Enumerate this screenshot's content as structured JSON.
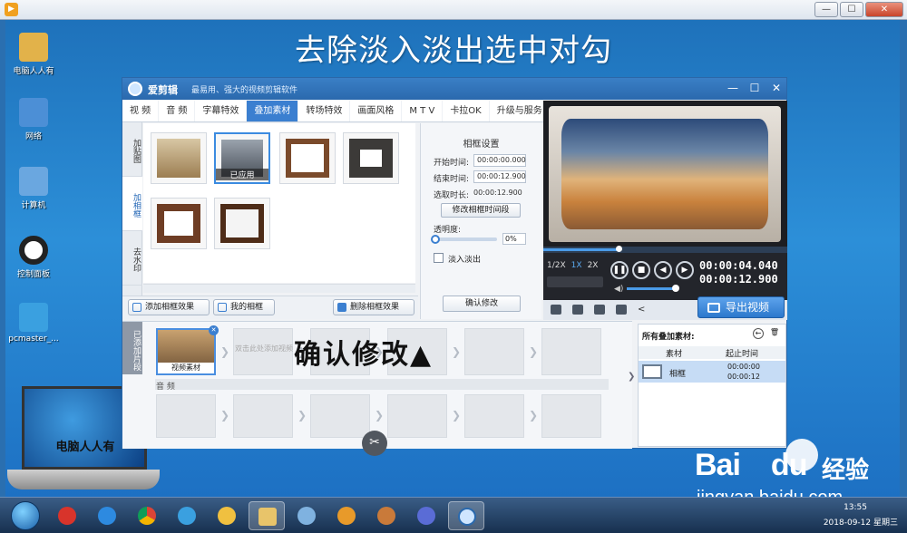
{
  "overlay_title": "去除淡入淡出选中对勾",
  "desktop_icons": [
    {
      "label": "电脑人人有",
      "color": "#e2b24a"
    },
    {
      "label": "网络",
      "color": "#4c8fd6"
    },
    {
      "label": "计算机",
      "color": "#6aa7e0"
    },
    {
      "label": "控制面板",
      "color": "#222222"
    },
    {
      "label": "pcmaster_...",
      "color": "#3aa0e0"
    }
  ],
  "logo_text": "电脑人人有",
  "app": {
    "name": "爱剪辑",
    "slogan": "最易用、强大的视频剪辑软件",
    "window_controls": [
      "—",
      "☐",
      "✕"
    ],
    "tabs": [
      "视  频",
      "音  频",
      "字幕特效",
      "叠加素材",
      "转场特效",
      "画面风格",
      "M T V",
      "卡拉OK",
      "升级与服务"
    ],
    "active_tab_index": 3,
    "side_tabs": [
      "加贴图",
      "加相框",
      "去水印"
    ],
    "active_side_tab_index": 1,
    "applied_label": "已应用",
    "buttons": {
      "add_frame": "添加相框效果",
      "my_frames": "我的相框",
      "delete_frame": "删除相框效果"
    }
  },
  "settings": {
    "title": "相框设置",
    "start_label": "开始时间:",
    "start_value": "00:00:00.000",
    "end_label": "结束时间:",
    "end_value": "00:00:12.900",
    "duration_label": "选取时长:",
    "duration_value": "00:00:12.900",
    "modify_time_button": "修改相框时间段",
    "opacity_label": "透明度:",
    "opacity_value": "0%",
    "fade_label": "淡入淡出",
    "fade_checked": false,
    "confirm_button": "确认修改"
  },
  "preview": {
    "speeds": [
      "1/2X",
      "1X",
      "2X"
    ],
    "active_speed_index": 1,
    "current_time": "00:00:04.040",
    "total_time": "00:00:12.900",
    "progress_fraction": 0.31,
    "volume_fraction": 0.85,
    "export_button": "导出视频"
  },
  "timeline": {
    "side_label": "已添加片段",
    "video_clip_label": "视频素材",
    "add_hint": "双击此处添加视频",
    "audio_label": "音 频"
  },
  "added_panel": {
    "title": "所有叠加素材:",
    "col_material": "素材",
    "col_start": "起止时间",
    "item_name": "相框",
    "item_start": "00:00:00",
    "item_end": "00:00:12"
  },
  "annotation_confirm": "确认修改▲",
  "watermark": {
    "logo": "Bai",
    "logo_tail": "du",
    "jingyan": "经验",
    "url": "jingyan.baidu.com"
  },
  "tray": {
    "time": "13:55",
    "date": "2018-09-12 星期三"
  },
  "colors": {
    "accent": "#3b7fd0",
    "titlebar": "#2a69ad",
    "desktop": "#2c8fd8"
  }
}
